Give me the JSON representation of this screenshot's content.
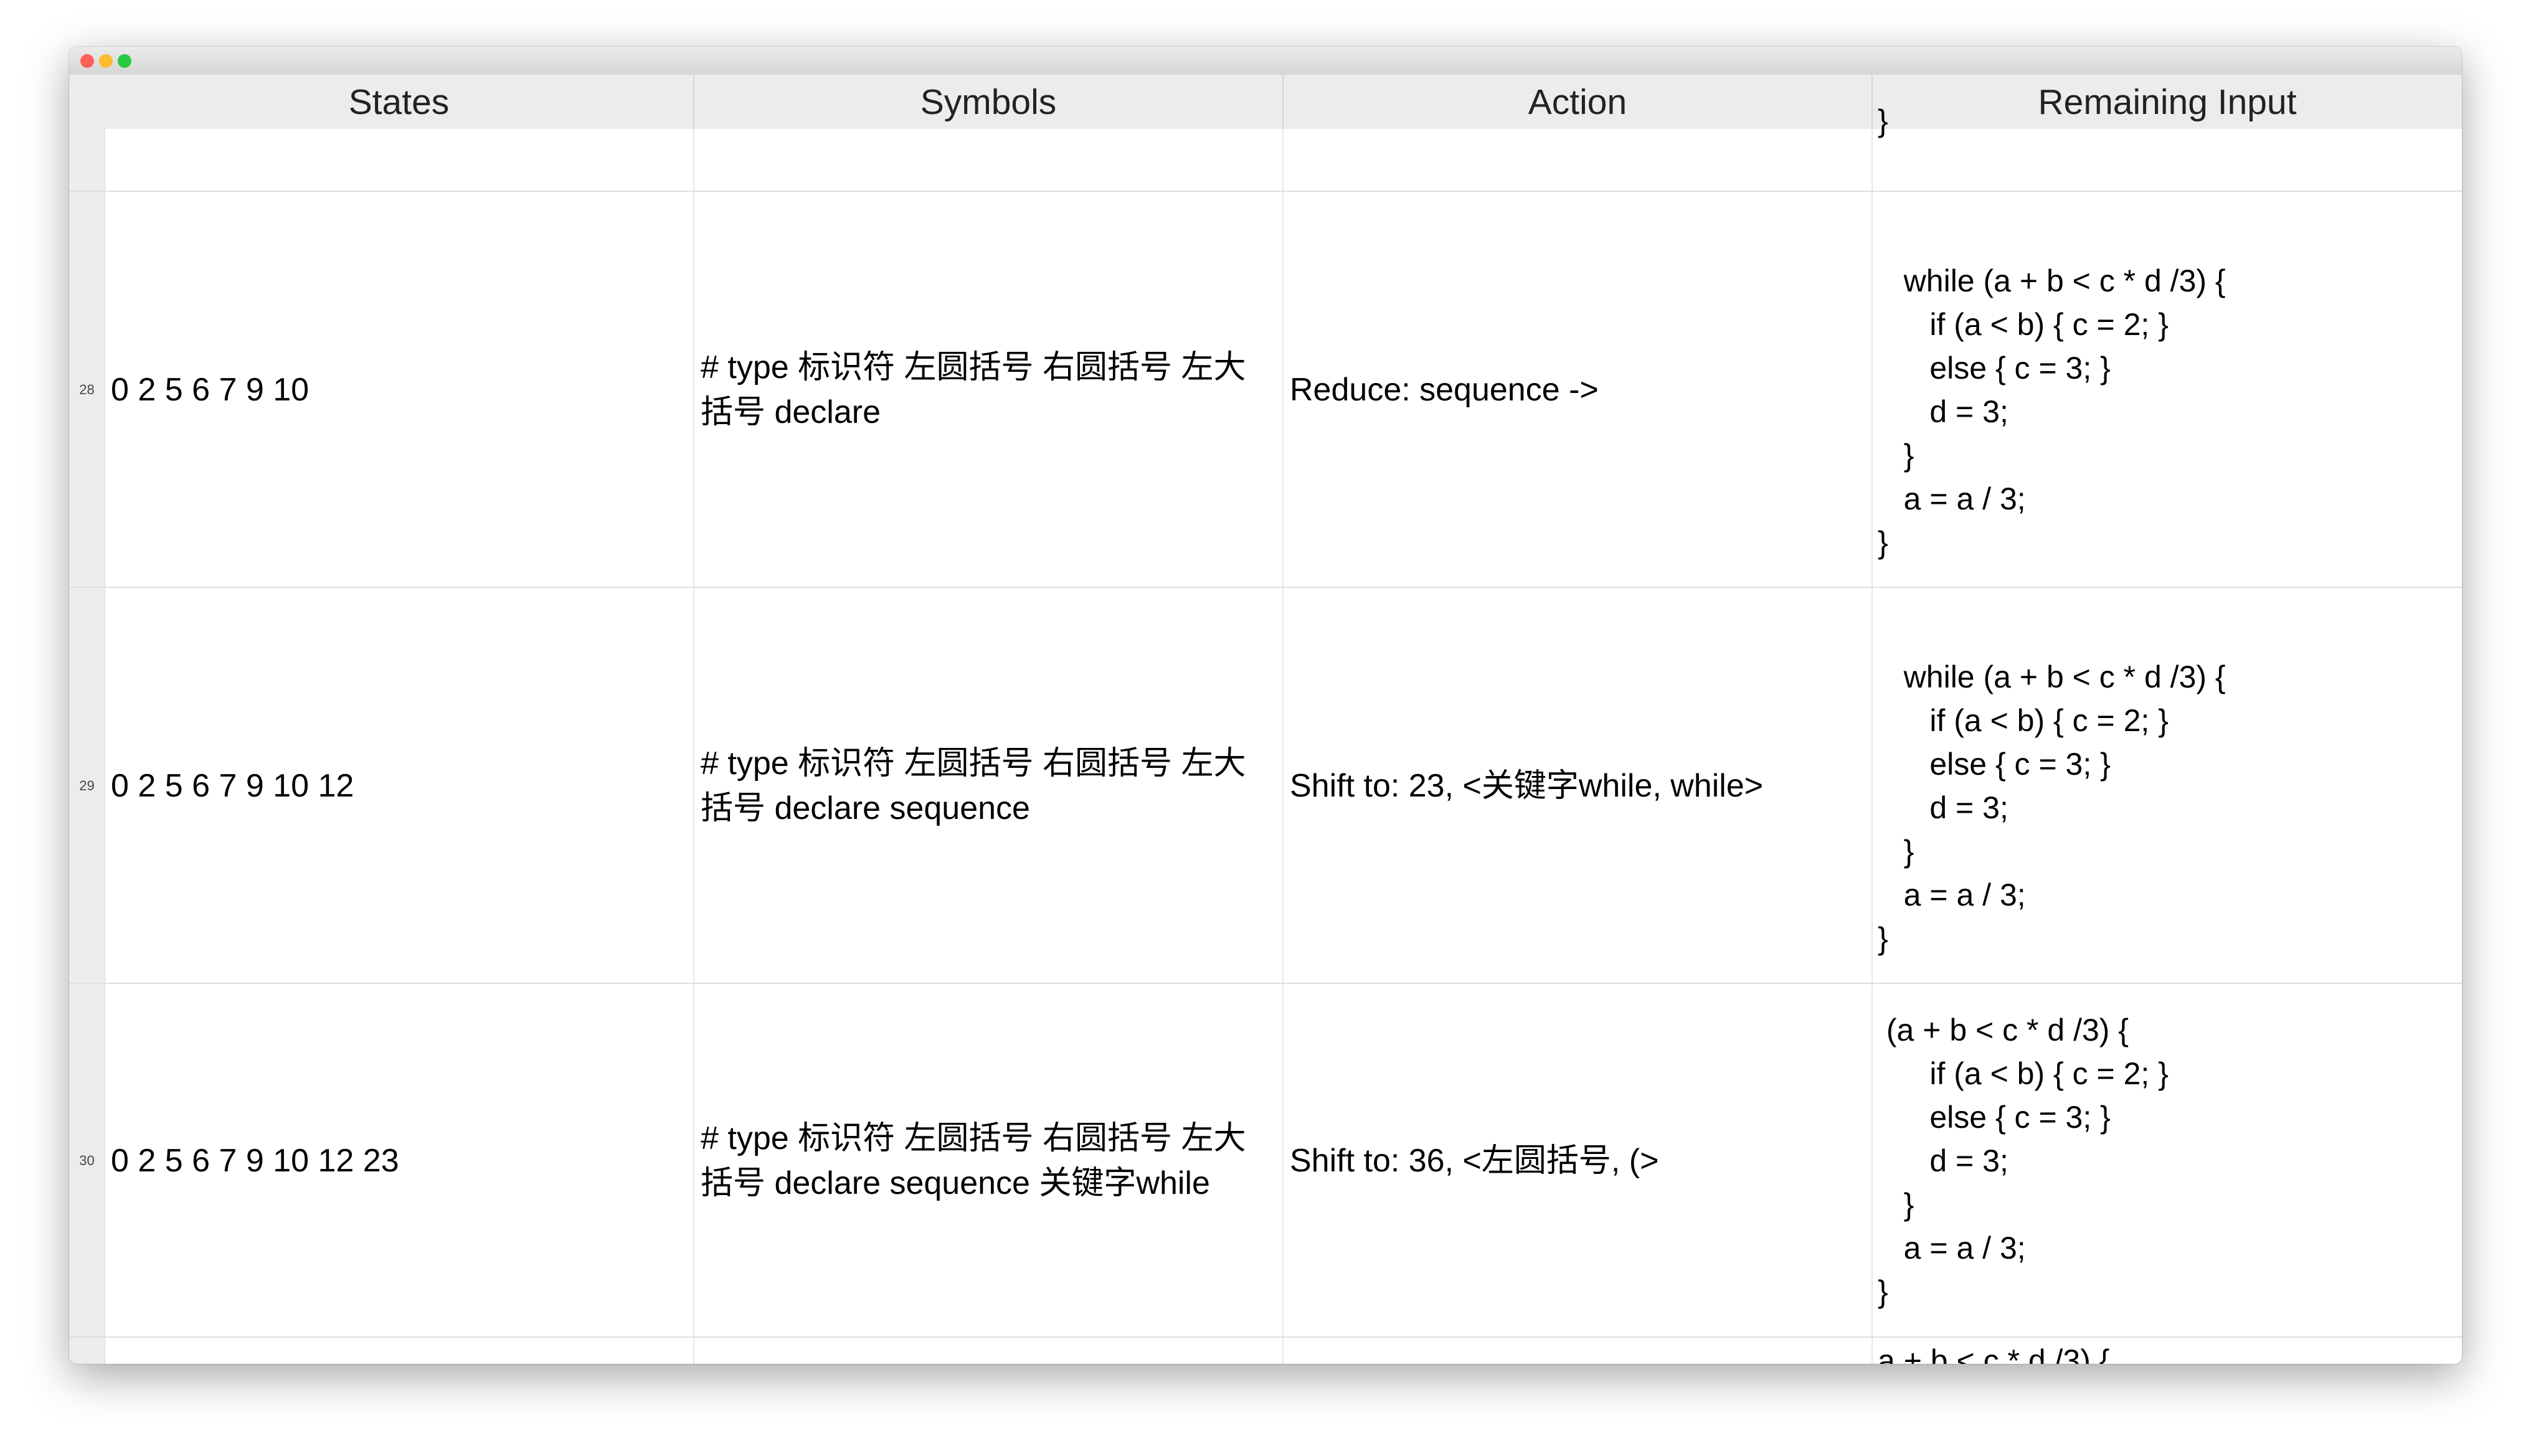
{
  "window": {
    "controls": [
      "close",
      "minimize",
      "zoom"
    ]
  },
  "table": {
    "columns": [
      "States",
      "Symbols",
      "Action",
      "Remaining Input"
    ],
    "top_partial_row": {
      "remaining_input": "}"
    },
    "rows": [
      {
        "number": "28",
        "states": "0 2 5 6 7 9 10",
        "symbols": "# type 标识符 左圆括号 右圆括号 左大括号 declare",
        "action": "Reduce: sequence ->",
        "remaining_input": "\n   while (a + b < c * d /3) {\n      if (a < b) { c = 2; }\n      else { c = 3; }\n      d = 3;\n   }\n   a = a / 3;\n}"
      },
      {
        "number": "29",
        "states": "0 2 5 6 7 9 10 12",
        "symbols": "# type 标识符 左圆括号 右圆括号 左大括号 declare sequence",
        "action": "Shift to: 23, <关键字while, while>",
        "remaining_input": "\n   while (a + b < c * d /3) {\n      if (a < b) { c = 2; }\n      else { c = 3; }\n      d = 3;\n   }\n   a = a / 3;\n}"
      },
      {
        "number": "30",
        "states": "0 2 5 6 7 9 10 12 23",
        "symbols": "# type 标识符 左圆括号 右圆括号 左大括号 declare sequence 关键字while",
        "action": "Shift to: 36, <左圆括号, (>",
        "remaining_input": " (a + b < c * d /3) {\n      if (a < b) { c = 2; }\n      else { c = 3; }\n      d = 3;\n   }\n   a = a / 3;\n}"
      }
    ],
    "bottom_partial_row": {
      "remaining_input": "a + b < c * d /3) {"
    }
  }
}
